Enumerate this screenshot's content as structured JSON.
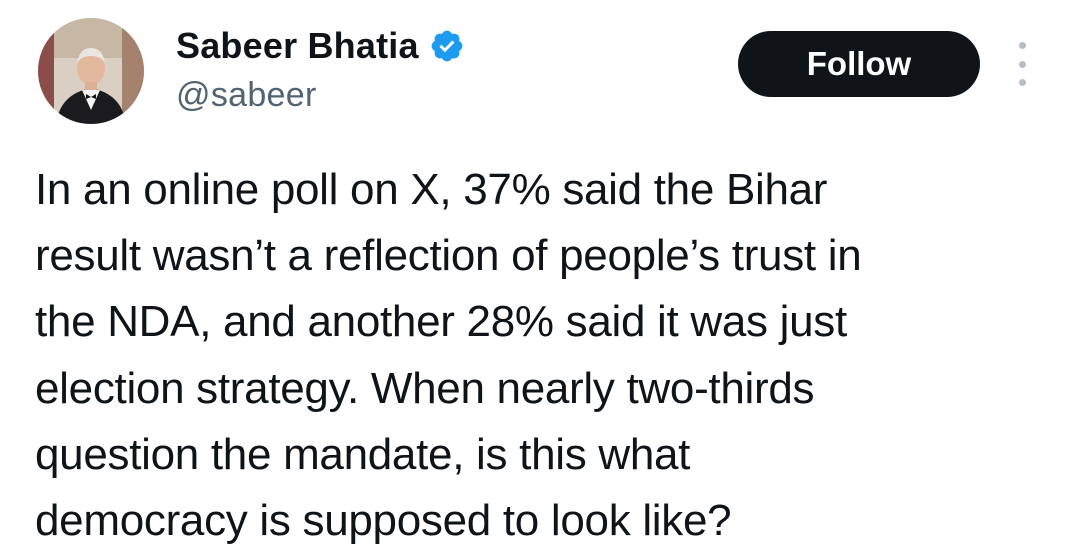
{
  "author": {
    "display_name": "Sabeer Bhatia",
    "handle": "@sabeer",
    "verified": true,
    "avatar_icon": "profile-photo",
    "verified_icon": "verified-badge-icon"
  },
  "actions": {
    "follow_label": "Follow",
    "more_icon": "more-options-icon"
  },
  "tweet": {
    "text": "In an online poll on X, 37% said the Bihar\nresult wasn’t a reflection of people’s trust in\nthe NDA, and another 28% said it was just\nelection strategy. When nearly two-thirds\nquestion the mandate, is this what\ndemocracy is supposed to look like?"
  },
  "colors": {
    "text_primary": "#0f1419",
    "text_secondary": "#536471",
    "follow_bg": "#0f1419",
    "verified_blue": "#1d9bf0"
  }
}
